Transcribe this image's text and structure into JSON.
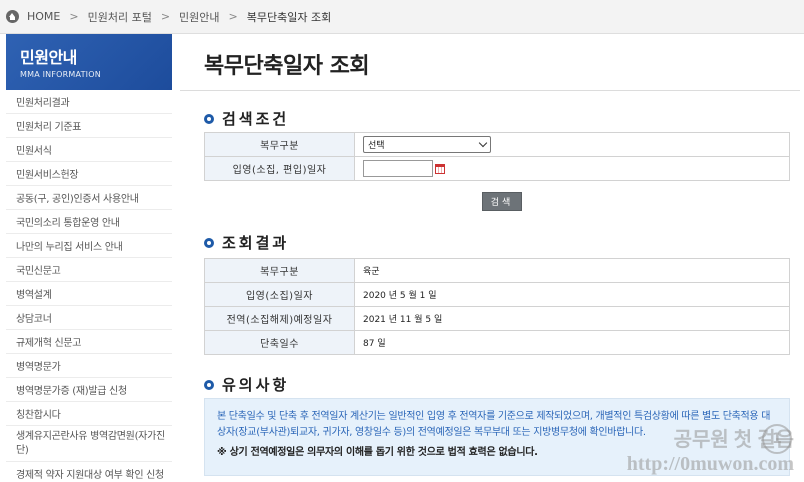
{
  "breadcrumb": {
    "items": [
      "HOME",
      "민원처리 포털",
      "민원안내",
      "복무단축일자 조회"
    ]
  },
  "sidebar": {
    "title": "민원안내",
    "subtitle": "MMA INFORMATION",
    "items": [
      "민원처리결과",
      "민원처리 기준표",
      "민원서식",
      "민원서비스헌장",
      "공동(구, 공인)인증서 사용안내",
      "국민의소리 통합운영 안내",
      "나만의 누리집 서비스 안내",
      "국민신문고",
      "병역설계",
      "상담코너",
      "규제개혁 신문고",
      "병역명문가",
      "병역명문가증 (재)발급 신청",
      "칭찬합시다",
      "생계유지곤란사유 병역감면원(자가진단)",
      "경제적 약자 지원대상 여부 확인 신청"
    ]
  },
  "page": {
    "title": "복무단축일자 조회"
  },
  "search": {
    "heading": "검색조건",
    "field1_label": "복무구분",
    "select_value": "선택",
    "field2_label": "입영(소집, 편입)일자",
    "button": "검색"
  },
  "results": {
    "heading": "조회결과",
    "rows": [
      {
        "label": "복무구분",
        "value": "육군"
      },
      {
        "label": "입영(소집)일자",
        "value": "2020 년 5 월 1 일"
      },
      {
        "label": "전역(소집해제)예정일자",
        "value": "2021 년 11 월 5 일"
      },
      {
        "label": "단축일수",
        "value": "87 일"
      }
    ]
  },
  "notice": {
    "heading": "유의사항",
    "text": "본 단축일수 및 단축 후 전역일자 계산기는 일반적인 입영 후 전역자를 기준으로 제작되었으며, 개별적인 특검상황에 따른 별도 단축적용 대상자(장교(부사관)퇴교자, 귀가자, 영창일수 등)의 전역예정일은 복무부대 또는 지방병무청에 확인바랍니다.",
    "warning": "※ 상기 전역예정일은 의무자의 이해를 돕기 위한 것으로 법적 효력은 없습니다."
  },
  "watermark": {
    "line1": "공무원 첫 걸음",
    "line2": "http://0muwon.com",
    "logo": "1"
  },
  "colors": {
    "accent": "#1e5aa8",
    "notice_bg": "#e6f1fb",
    "header_cell": "#eef3f9"
  }
}
